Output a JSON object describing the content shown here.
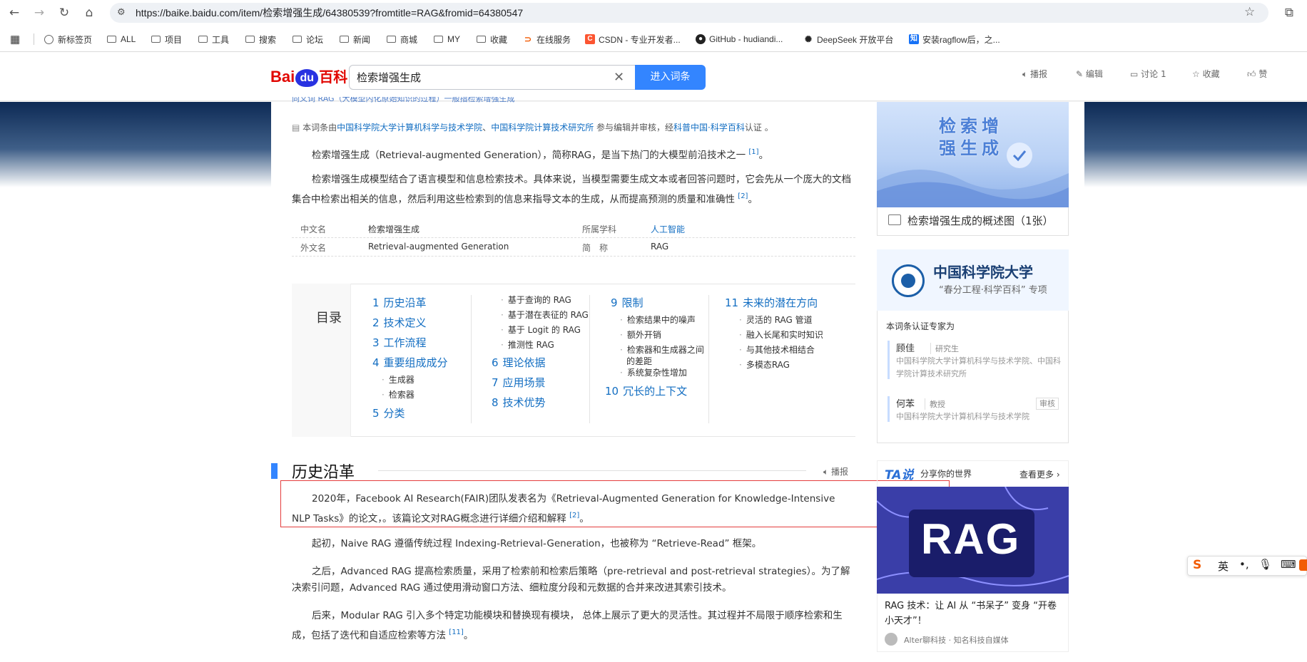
{
  "browser": {
    "url": "https://baike.baidu.com/item/检索增强生成/64380539?fromtitle=RAG&fromid=64380547",
    "bookmarks": [
      "新标签页",
      "ALL",
      "项目",
      "工具",
      "搜索",
      "论坛",
      "新闻",
      "商城",
      "MY",
      "收藏",
      "在线服务",
      "CSDN - 专业开发者...",
      "GitHub - hudiandi...",
      "DeepSeek 开放平台",
      "安装ragflow后，之..."
    ]
  },
  "header": {
    "logo_bai": "Bai",
    "logo_du": "du",
    "logo_baike": "百科",
    "search_value": "检索增强生成",
    "search_button": "进入词条",
    "actions": [
      "播报",
      "编辑",
      "讨论 1",
      "收藏",
      "赞"
    ]
  },
  "article": {
    "clipped_line": "同义词   RAG（大模型内化原始知识的过程）一般指检索增强生成",
    "cert_prefix": "本词条由",
    "cert_org1": "中国科学院大学计算机科学与技术学院",
    "cert_sep": "、",
    "cert_org2": "中国科学院计算技术研究所",
    "cert_mid": " 参与编辑并审核，经",
    "cert_org3": "科普中国·科学百科",
    "cert_suffix": "认证 。",
    "p1": "检索增强生成（Retrieval-augmented Generation），简称RAG，是当下热门的大模型前沿技术之一",
    "p1_ref": "[1]",
    "p1_end": "。",
    "p2": "检索增强生成模型结合了语言模型和信息检索技术。具体来说，当模型需要生成文本或者回答问题时，它会先从一个庞大的文档集合中检索出相关的信息，然后利用这些检索到的信息来指导文本的生成，从而提高预测的质量和准确性",
    "p2_ref": "[2]",
    "p2_end": "。",
    "info": {
      "k1": "中文名",
      "v1": "检索增强生成",
      "k2": "所属学科",
      "v2": "人工智能",
      "k3": "外文名",
      "v3": "Retrieval-augmented Generation",
      "k4": "简　称",
      "v4": "RAG"
    },
    "toc_title": "目录",
    "toc": {
      "i1": {
        "n": "1",
        "t": "历史沿革"
      },
      "i2": {
        "n": "2",
        "t": "技术定义"
      },
      "i3": {
        "n": "3",
        "t": "工作流程"
      },
      "i4": {
        "n": "4",
        "t": "重要组成成分"
      },
      "i4a": "生成器",
      "i4b": "检索器",
      "i5": {
        "n": "5",
        "t": "分类"
      },
      "s1": "基于查询的 RAG",
      "s2": "基于潜在表征的 RAG",
      "s3": "基于 Logit 的 RAG",
      "s4": "推测性 RAG",
      "i6": {
        "n": "6",
        "t": "理论依据"
      },
      "i7": {
        "n": "7",
        "t": "应用场景"
      },
      "i8": {
        "n": "8",
        "t": "技术优势"
      },
      "i9": {
        "n": "9",
        "t": "限制"
      },
      "i9a": "检索结果中的噪声",
      "i9b": "额外开销",
      "i9c": "检索器和生成器之间",
      "i9c2": "的差距",
      "i9d": "系统复杂性增加",
      "i10": {
        "n": "10",
        "t": "冗长的上下文"
      },
      "i11": {
        "n": "11",
        "t": "未来的潜在方向"
      },
      "i11a": "灵活的 RAG 管道",
      "i11b": "融入长尾和实时知识",
      "i11c": "与其他技术相结合",
      "i11d": "多模态RAG"
    },
    "section_title": "历史沿革",
    "section_action": "播报",
    "h1": "2020年，Facebook AI Research(FAIR)团队发表名为《Retrieval-Augmented Generation for Knowledge-Intensive NLP Tasks》的论文，。该篇论文对RAG概念进行详细介绍和解释",
    "h1_ref": "[2]",
    "h1_end": "。",
    "h2": "起初，Naive RAG 遵循传统过程 Indexing-Retrieval-Generation，也被称为 “Retrieve-Read” 框架。",
    "h3": "之后，Advanced RAG 提高检索质量，采用了检索前和检索后策略（pre-retrieval and post-retrieval strategies）。为了解决索引问题，Advanced RAG 通过使用滑动窗口方法、细粒度分段和元数据的合并来改进其索引技术。",
    "h4": "后来，Modular RAG 引入多个特定功能模块和替换现有模块， 总体上展示了更大的灵活性。其过程并不局限于顺序检索和生成，包括了迭代和自适应检索等方法",
    "h4_ref": "[11]",
    "h4_end": "。"
  },
  "sidebar": {
    "image_text": "检索增强生成",
    "image_caption": "检索增强生成的概述图（1张）",
    "org_name": "中国科学院大学",
    "org_sub": "“春分工程·科学百科” 专项",
    "expert_title": "本词条认证专家为",
    "e1_name": "顾佳",
    "e1_role": "研究生",
    "e1_org": "中国科学院大学计算机科学与技术学院、中国科学院计算技术研究所",
    "e2_name": "何苯",
    "e2_role": "教授",
    "e2_badge": "审核",
    "e2_org": "中国科学院大学计算机科学与技术学院",
    "ta_logo": "TA说",
    "ta_sub": "分享你的世界",
    "ta_more": "查看更多",
    "video_word": "RAG",
    "video_title": "RAG 技术：让 AI 从 “书呆子” 变身 “开卷小天才”！",
    "video_author": "Alter聊科技 · 知名科技自媒体"
  },
  "ime": {
    "lang": "英"
  }
}
